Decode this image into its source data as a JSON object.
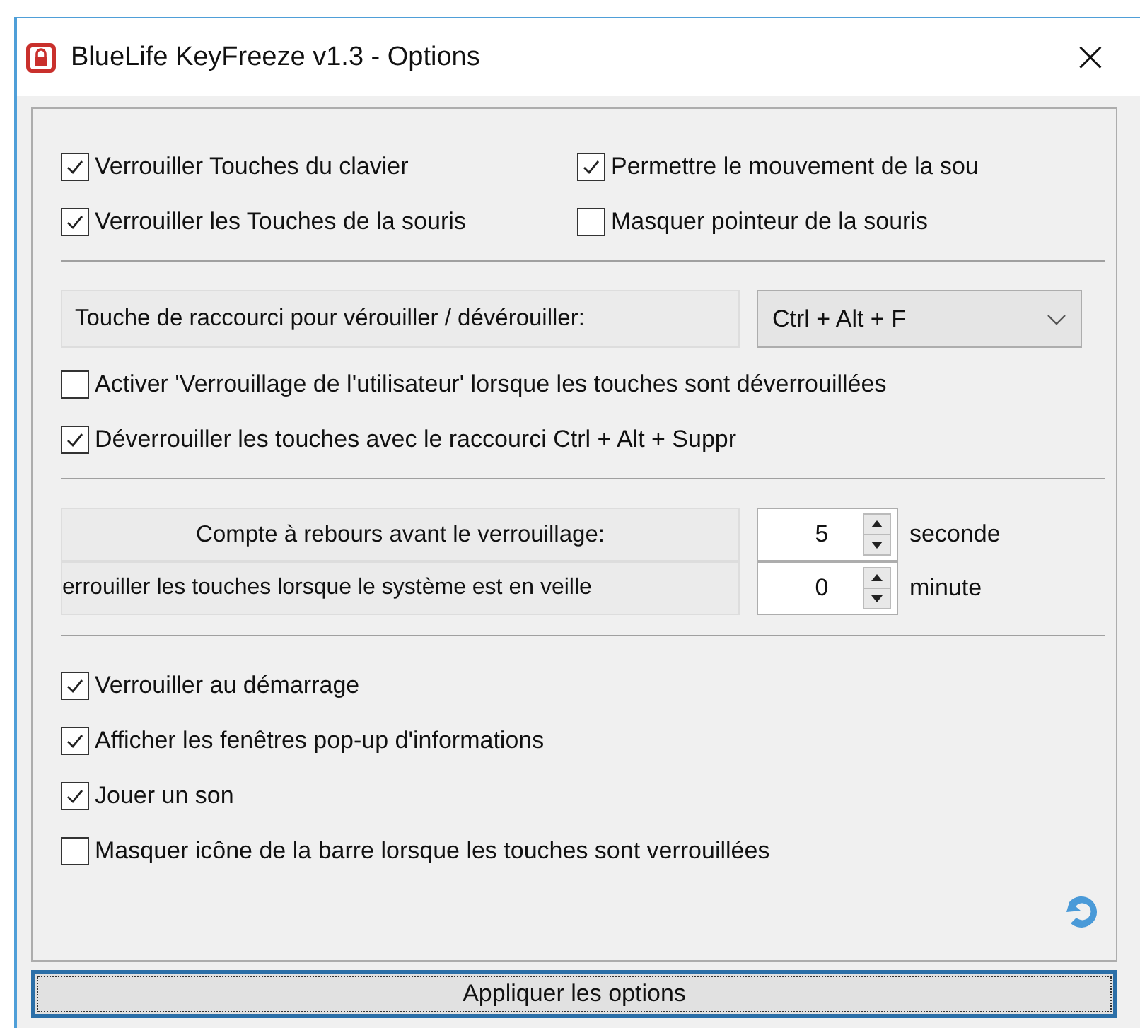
{
  "window": {
    "title": "BlueLife KeyFreeze v1.3 - Options",
    "close": "×"
  },
  "lock_options": [
    {
      "label": "Verrouiller Touches du clavier",
      "checked": true
    },
    {
      "label": "Permettre le mouvement de la sou",
      "checked": true
    },
    {
      "label": "Verrouiller les Touches de la souris",
      "checked": true
    },
    {
      "label": "Masquer pointeur de la souris",
      "checked": false
    }
  ],
  "hotkey": {
    "label": "Touche de raccourci pour vérouiller / dévérouiller:",
    "value": "Ctrl + Alt + F"
  },
  "hotkey_options": [
    {
      "label": "Activer 'Verrouillage de l'utilisateur' lorsque les touches sont déverrouillées",
      "checked": false
    },
    {
      "label": "Déverrouiller les touches avec le raccourci Ctrl + Alt + Suppr",
      "checked": true
    }
  ],
  "timers": [
    {
      "label": "Compte à rebours avant le verrouillage:",
      "value": "5",
      "unit": "seconde"
    },
    {
      "label": "errouiller les touches lorsque le système est en veille",
      "value": "0",
      "unit": "minute"
    }
  ],
  "general_options": [
    {
      "label": "Verrouiller au démarrage",
      "checked": true
    },
    {
      "label": "Afficher les fenêtres pop-up d'informations",
      "checked": true
    },
    {
      "label": "Jouer un son",
      "checked": true
    },
    {
      "label": "Masquer icône de la barre lorsque les touches sont verrouillées",
      "checked": false
    }
  ],
  "apply_button": "Appliquer les options"
}
